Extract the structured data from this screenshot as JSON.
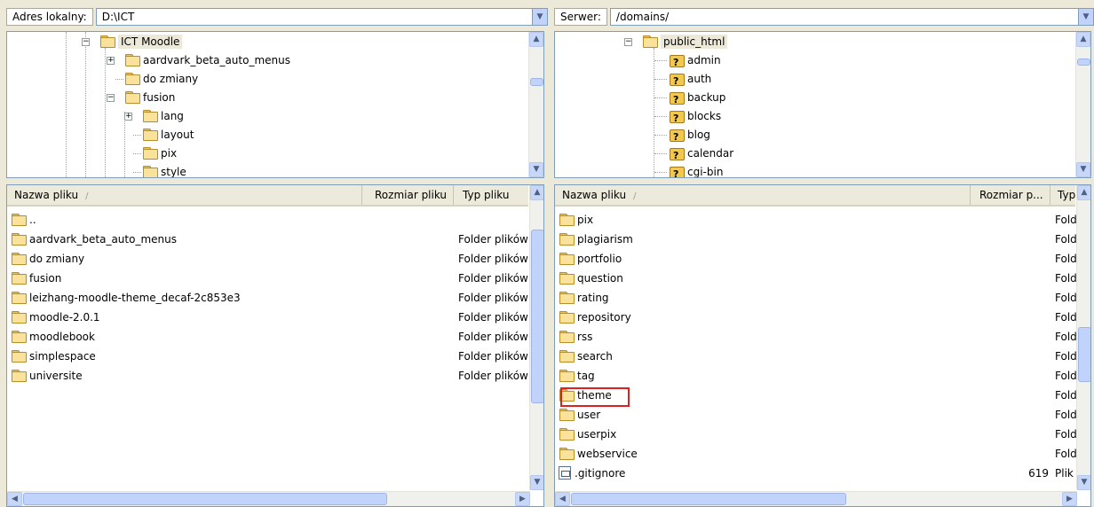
{
  "local": {
    "address_label": "Adres lokalny:",
    "address_value": "D:\\ICT",
    "tree": [
      {
        "label": "ICT Moodle",
        "indent": 0,
        "expander": "−"
      },
      {
        "label": "aardvark_beta_auto_menus",
        "indent": 1,
        "expander": "+"
      },
      {
        "label": "do zmiany",
        "indent": 1,
        "expander": ""
      },
      {
        "label": "fusion",
        "indent": 1,
        "expander": "−"
      },
      {
        "label": "lang",
        "indent": 2,
        "expander": "+"
      },
      {
        "label": "layout",
        "indent": 2,
        "expander": ""
      },
      {
        "label": "pix",
        "indent": 2,
        "expander": ""
      },
      {
        "label": "style",
        "indent": 2,
        "expander": ""
      }
    ],
    "columns": {
      "name": "Nazwa pliku",
      "size": "Rozmiar pliku",
      "type": "Typ pliku"
    },
    "files": [
      {
        "name": "..",
        "type": ""
      },
      {
        "name": "aardvark_beta_auto_menus",
        "type": "Folder plików"
      },
      {
        "name": "do zmiany",
        "type": "Folder plików"
      },
      {
        "name": "fusion",
        "type": "Folder plików"
      },
      {
        "name": "leizhang-moodle-theme_decaf-2c853e3",
        "type": "Folder plików"
      },
      {
        "name": "moodle-2.0.1",
        "type": "Folder plików"
      },
      {
        "name": "moodlebook",
        "type": "Folder plików"
      },
      {
        "name": "simplespace",
        "type": "Folder plików"
      },
      {
        "name": "universite",
        "type": "Folder plików"
      }
    ]
  },
  "remote": {
    "address_label": "Serwer:",
    "address_value": "/domains/",
    "tree": [
      {
        "label": "public_html",
        "indent": 0,
        "expander": "−",
        "q": false
      },
      {
        "label": "admin",
        "indent": 1,
        "q": true
      },
      {
        "label": "auth",
        "indent": 1,
        "q": true
      },
      {
        "label": "backup",
        "indent": 1,
        "q": true
      },
      {
        "label": "blocks",
        "indent": 1,
        "q": true
      },
      {
        "label": "blog",
        "indent": 1,
        "q": true
      },
      {
        "label": "calendar",
        "indent": 1,
        "q": true
      },
      {
        "label": "cgi-bin",
        "indent": 1,
        "q": true
      }
    ],
    "columns": {
      "name": "Nazwa pliku",
      "size": "Rozmiar p...",
      "type": "Typ"
    },
    "files": [
      {
        "name": "pix",
        "size": "",
        "type": "Fold",
        "icon": "folder"
      },
      {
        "name": "plagiarism",
        "size": "",
        "type": "Fold",
        "icon": "folder"
      },
      {
        "name": "portfolio",
        "size": "",
        "type": "Fold",
        "icon": "folder"
      },
      {
        "name": "question",
        "size": "",
        "type": "Fold",
        "icon": "folder"
      },
      {
        "name": "rating",
        "size": "",
        "type": "Fold",
        "icon": "folder"
      },
      {
        "name": "repository",
        "size": "",
        "type": "Fold",
        "icon": "folder"
      },
      {
        "name": "rss",
        "size": "",
        "type": "Fold",
        "icon": "folder"
      },
      {
        "name": "search",
        "size": "",
        "type": "Fold",
        "icon": "folder"
      },
      {
        "name": "tag",
        "size": "",
        "type": "Fold",
        "icon": "folder"
      },
      {
        "name": "theme",
        "size": "",
        "type": "Fold",
        "icon": "folder",
        "highlighted": true
      },
      {
        "name": "user",
        "size": "",
        "type": "Fold",
        "icon": "folder"
      },
      {
        "name": "userpix",
        "size": "",
        "type": "Fold",
        "icon": "folder"
      },
      {
        "name": "webservice",
        "size": "",
        "type": "Fold",
        "icon": "folder"
      },
      {
        "name": ".gitignore",
        "size": "619",
        "type": "Plik",
        "icon": "file"
      }
    ]
  },
  "colors": {
    "highlight": "#e0201f",
    "border": "#7f9db9",
    "scroll": "#c1d3fb"
  },
  "icons": {
    "dropdown": "chevron-down-icon",
    "folder": "folder-icon",
    "unknown_folder": "question-folder-icon",
    "file": "file-icon"
  },
  "glyphs": {
    "down": "▼",
    "up": "▲",
    "left": "◀",
    "right": "▶",
    "sort": "/"
  }
}
